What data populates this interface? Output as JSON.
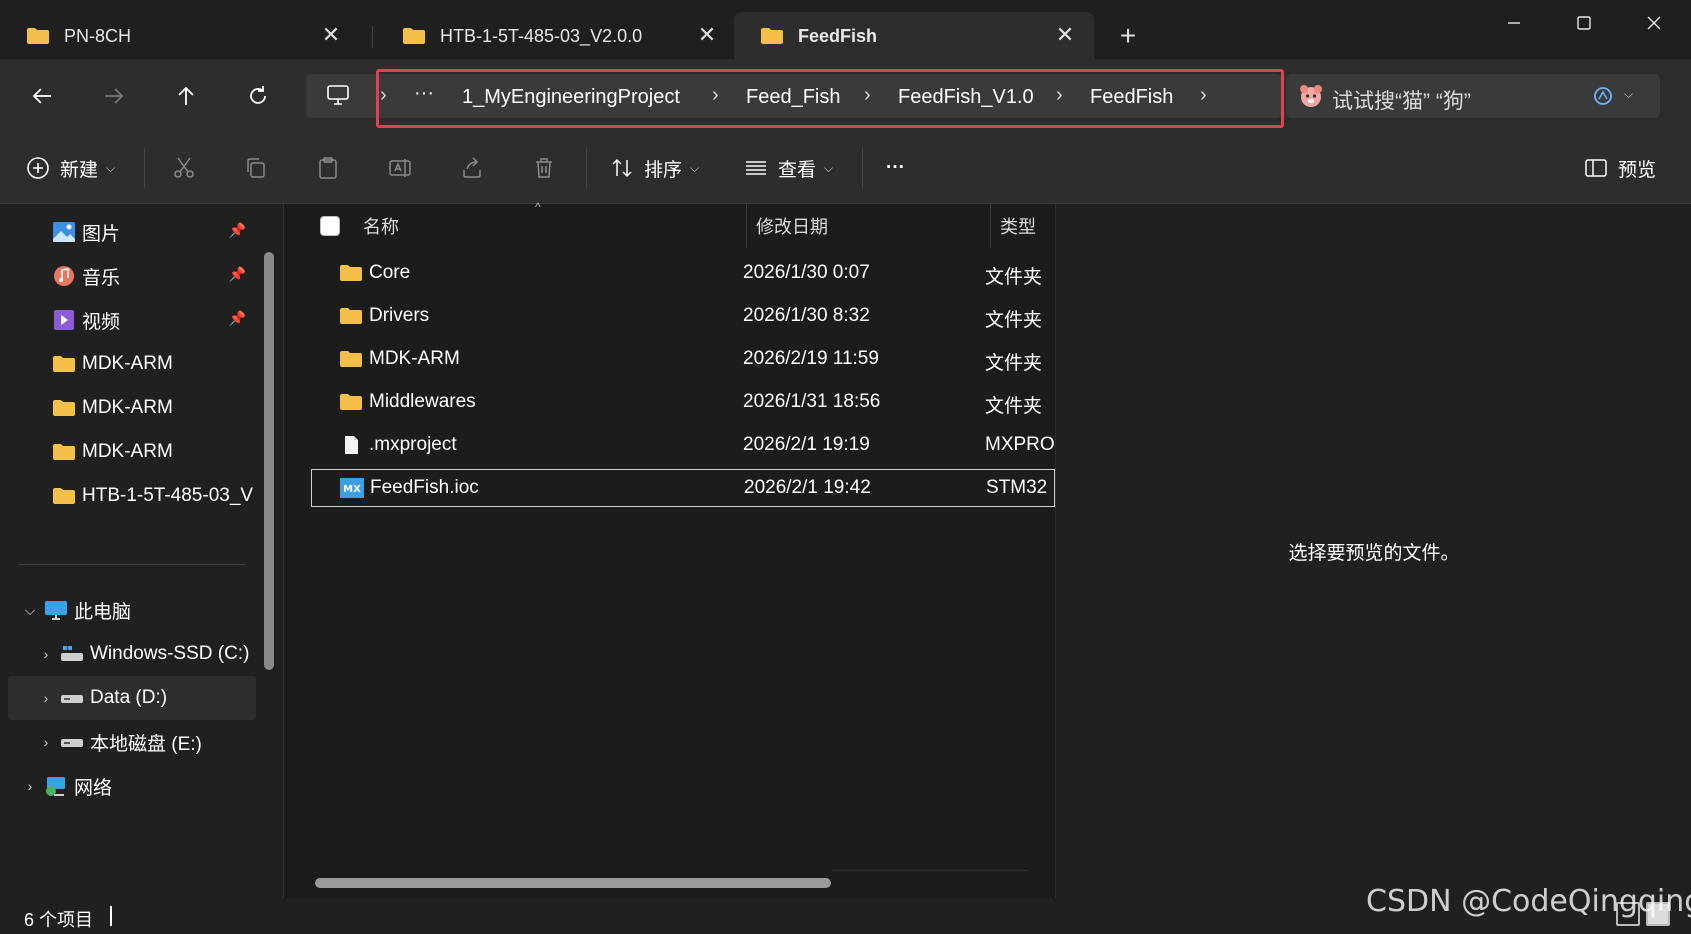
{
  "tabs": [
    {
      "label": "PN-8CH",
      "active": false
    },
    {
      "label": "HTB-1-5T-485-03_V2.0.0",
      "active": false
    },
    {
      "label": "FeedFish",
      "active": true
    }
  ],
  "breadcrumb": {
    "overflow": "···",
    "items": [
      "1_MyEngineeringProject",
      "Feed_Fish",
      "FeedFish_V1.0",
      "FeedFish"
    ]
  },
  "search": {
    "placeholder": "试试搜“猫” “狗”"
  },
  "commands": {
    "new": "新建",
    "sort": "排序",
    "view": "查看",
    "more": "···",
    "preview": "预览"
  },
  "sidebar": {
    "quick_access": [
      {
        "label": "图片",
        "icon": "pictures-icon",
        "pinned": true
      },
      {
        "label": "音乐",
        "icon": "music-icon",
        "pinned": true
      },
      {
        "label": "视频",
        "icon": "videos-icon",
        "pinned": true
      },
      {
        "label": "MDK-ARM",
        "icon": "folder-icon",
        "pinned": false
      },
      {
        "label": "MDK-ARM",
        "icon": "folder-icon",
        "pinned": false
      },
      {
        "label": "MDK-ARM",
        "icon": "folder-icon",
        "pinned": false
      },
      {
        "label": "HTB-1-5T-485-03_V",
        "icon": "folder-icon",
        "pinned": false
      }
    ],
    "this_pc": "此电脑",
    "drives": [
      {
        "label": "Windows-SSD (C:)",
        "icon": "system-drive-icon",
        "selected": false
      },
      {
        "label": "Data (D:)",
        "icon": "drive-icon",
        "selected": true
      },
      {
        "label": "本地磁盘 (E:)",
        "icon": "drive-icon",
        "selected": false
      }
    ],
    "network": "网络"
  },
  "columns": {
    "name": "名称",
    "date": "修改日期",
    "type": "类型"
  },
  "files": [
    {
      "name": "Core",
      "date": "2026/1/30 0:07",
      "type": "文件夹",
      "icon": "folder-icon",
      "selected": false
    },
    {
      "name": "Drivers",
      "date": "2026/1/30 8:32",
      "type": "文件夹",
      "icon": "folder-icon",
      "selected": false
    },
    {
      "name": "MDK-ARM",
      "date": "2026/2/19 11:59",
      "type": "文件夹",
      "icon": "folder-icon",
      "selected": false
    },
    {
      "name": "Middlewares",
      "date": "2026/1/31 18:56",
      "type": "文件夹",
      "icon": "folder-icon",
      "selected": false
    },
    {
      "name": ".mxproject",
      "date": "2026/2/1 19:19",
      "type": "MXPROJECT",
      "icon": "file-icon",
      "selected": false
    },
    {
      "name": "FeedFish.ioc",
      "date": "2026/2/1 19:42",
      "type": "STM32",
      "icon": "stm32cubemx-icon",
      "selected": true
    }
  ],
  "preview_message": "选择要预览的文件。",
  "status": {
    "count": "6 个项目"
  },
  "watermark": "CSDN @CodeQingqing",
  "colors": {
    "accent": "#e0434f",
    "folder": "#f5c04a",
    "background": "#1c1c1c"
  }
}
